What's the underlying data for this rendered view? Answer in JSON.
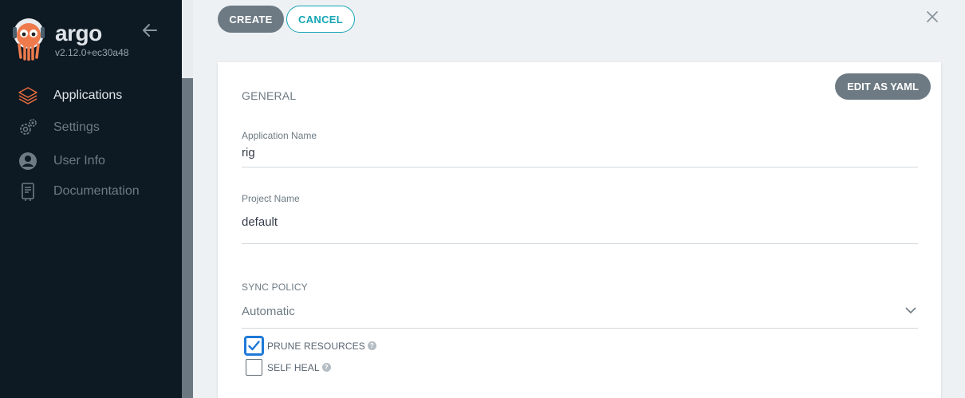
{
  "brand": {
    "name": "argo",
    "version": "v2.12.0+ec30a48"
  },
  "sidebar": {
    "items": [
      {
        "label": "Applications",
        "icon": "layers-icon",
        "active": true
      },
      {
        "label": "Settings",
        "icon": "gears-icon",
        "active": false
      },
      {
        "label": "User Info",
        "icon": "user-circle-icon",
        "active": false
      },
      {
        "label": "Documentation",
        "icon": "book-icon",
        "active": false
      }
    ]
  },
  "toolbar": {
    "create_label": "CREATE",
    "cancel_label": "CANCEL"
  },
  "card": {
    "edit_yaml_label": "EDIT AS YAML",
    "general_title": "GENERAL",
    "app_name": {
      "label": "Application Name",
      "value": "rig"
    },
    "project_name": {
      "label": "Project Name",
      "value": "default"
    },
    "sync_policy": {
      "title": "SYNC POLICY",
      "selected": "Automatic",
      "options": [
        {
          "label": "PRUNE RESOURCES",
          "checked": true
        },
        {
          "label": "SELF HEAL",
          "checked": false
        }
      ]
    }
  },
  "colors": {
    "sidebar_bg": "#0d1a23",
    "accent": "#15a5b4",
    "active_icon": "#e96d3e",
    "button_gray": "#6d7a83",
    "checkbox_blue": "#1e79d8"
  }
}
